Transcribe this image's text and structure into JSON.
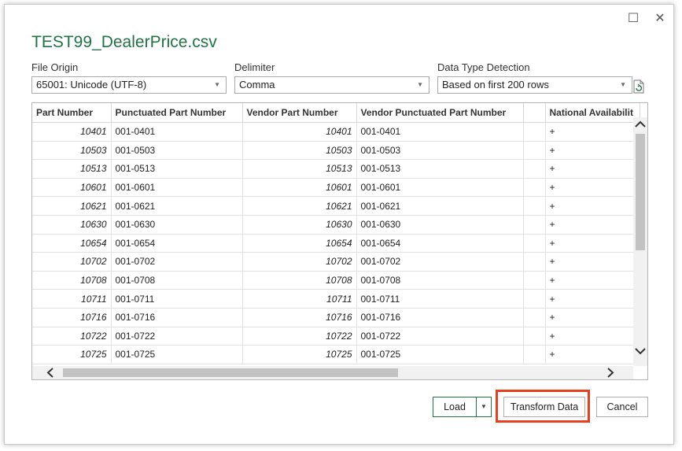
{
  "dialog": {
    "title": "TEST99_DealerPrice.csv",
    "maximize_glyph": "☐",
    "close_glyph": "✕"
  },
  "file_origin": {
    "label": "File Origin",
    "value": "65001: Unicode (UTF-8)"
  },
  "delimiter": {
    "label": "Delimiter",
    "value": "Comma"
  },
  "data_type_detection": {
    "label": "Data Type Detection",
    "value": "Based on first 200 rows"
  },
  "icons": {
    "refresh": "refresh-icon",
    "dropdown": "chevron-down-icon"
  },
  "table": {
    "columns": [
      "Part Number",
      "Punctuated Part Number",
      "Vendor Part Number",
      "Vendor Punctuated Part Number",
      "",
      "National Availabilit"
    ],
    "rows": [
      [
        "10401",
        "001-0401",
        "10401",
        "001-0401",
        "",
        "+"
      ],
      [
        "10503",
        "001-0503",
        "10503",
        "001-0503",
        "",
        "+"
      ],
      [
        "10513",
        "001-0513",
        "10513",
        "001-0513",
        "",
        "+"
      ],
      [
        "10601",
        "001-0601",
        "10601",
        "001-0601",
        "",
        "+"
      ],
      [
        "10621",
        "001-0621",
        "10621",
        "001-0621",
        "",
        "+"
      ],
      [
        "10630",
        "001-0630",
        "10630",
        "001-0630",
        "",
        "+"
      ],
      [
        "10654",
        "001-0654",
        "10654",
        "001-0654",
        "",
        "+"
      ],
      [
        "10702",
        "001-0702",
        "10702",
        "001-0702",
        "",
        "+"
      ],
      [
        "10708",
        "001-0708",
        "10708",
        "001-0708",
        "",
        "+"
      ],
      [
        "10711",
        "001-0711",
        "10711",
        "001-0711",
        "",
        "+"
      ],
      [
        "10716",
        "001-0716",
        "10716",
        "001-0716",
        "",
        "+"
      ],
      [
        "10722",
        "001-0722",
        "10722",
        "001-0722",
        "",
        "+"
      ],
      [
        "10725",
        "001-0725",
        "10725",
        "001-0725",
        "",
        "+"
      ]
    ]
  },
  "buttons": {
    "load": "Load",
    "load_dropdown": "▼",
    "transform": "Transform Data",
    "cancel": "Cancel"
  },
  "colors": {
    "accent": "#217346",
    "highlight": "#e8401c"
  }
}
